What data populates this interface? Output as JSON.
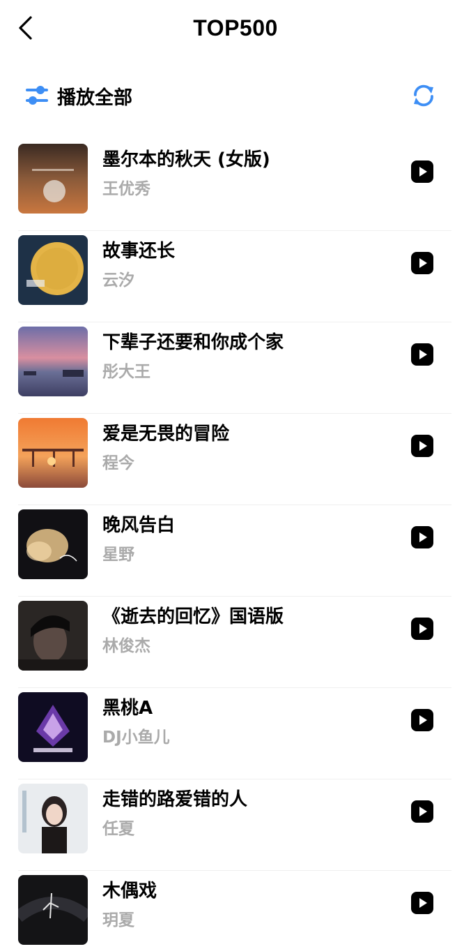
{
  "header": {
    "title": "TOP500",
    "back_icon": "back-chevron-icon"
  },
  "toolbar": {
    "play_all_label": "播放全部",
    "filter_icon": "sliders-icon",
    "refresh_icon": "refresh-icon",
    "accent_color": "#3d8ef5"
  },
  "songs": [
    {
      "title": "墨尔本的秋天 (女版)",
      "artist": "王优秀"
    },
    {
      "title": "故事还长",
      "artist": "云汐"
    },
    {
      "title": "下辈子还要和你成个家",
      "artist": "彤大王"
    },
    {
      "title": "爱是无畏的冒险",
      "artist": "程今"
    },
    {
      "title": "晚风告白",
      "artist": "星野"
    },
    {
      "title": "《逝去的回忆》国语版",
      "artist": "林俊杰"
    },
    {
      "title": "黑桃A",
      "artist": "DJ小鱼儿"
    },
    {
      "title": "走错的路爱错的人",
      "artist": "任夏"
    },
    {
      "title": "木偶戏",
      "artist": "玥夏"
    }
  ]
}
